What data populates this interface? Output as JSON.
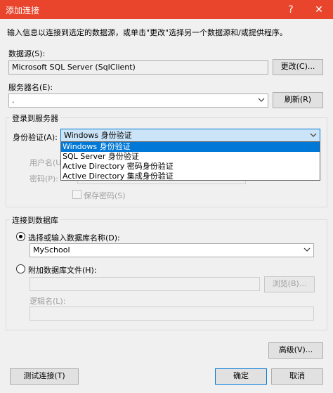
{
  "window": {
    "title": "添加连接",
    "help_label": "?",
    "close_label": "✕"
  },
  "instruction": "输入信息以连接到选定的数据源，或单击\"更改\"选择另一个数据源和/或提供程序。",
  "datasource": {
    "label": "数据源(S):",
    "value": "Microsoft SQL Server (SqlClient)",
    "change_label": "更改(C)..."
  },
  "server": {
    "label": "服务器名(E):",
    "value": ".",
    "refresh_label": "刷新(R)"
  },
  "login": {
    "group_label": "登录到服务器",
    "auth_label": "身份验证(A):",
    "auth_value": "Windows 身份验证",
    "auth_options": [
      "Windows 身份验证",
      "SQL Server 身份验证",
      "Active Directory 密码身份验证",
      "Active Directory 集成身份验证"
    ],
    "username_label": "用户名(U):",
    "password_label": "密码(P):",
    "save_password_label": "保存密码(S)"
  },
  "database": {
    "group_label": "连接到数据库",
    "select_label": "选择或输入数据库名称(D):",
    "select_value": "MySchool",
    "attach_label": "附加数据库文件(H):",
    "browse_label": "浏览(B)...",
    "logical_label": "逻辑名(L):"
  },
  "buttons": {
    "advanced": "高级(V)...",
    "test": "测试连接(T)",
    "ok": "确定",
    "cancel": "取消"
  },
  "colors": {
    "titlebar": "#e8452c",
    "selection": "#0078d7"
  }
}
